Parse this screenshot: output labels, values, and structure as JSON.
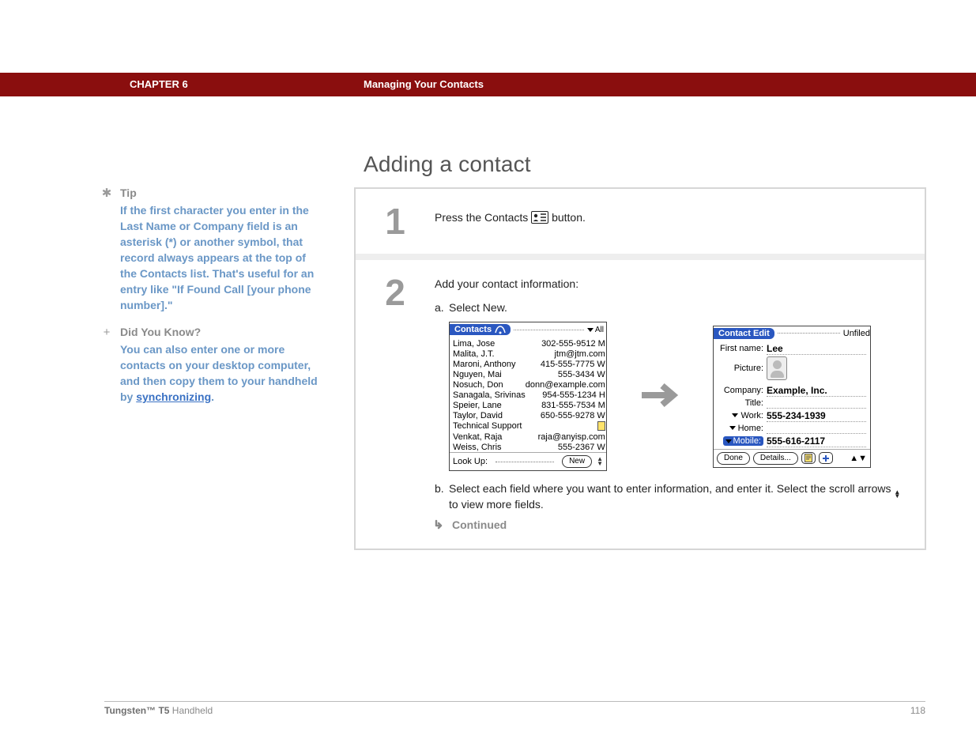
{
  "header": {
    "chapter": "CHAPTER 6",
    "subtitle": "Managing Your Contacts"
  },
  "heading": "Adding a contact",
  "sidebar": {
    "tip": {
      "title": "Tip",
      "body": "If the first character you enter in the Last Name or Company field is an asterisk (*) or another symbol, that record always appears at the top of the Contacts list. That's useful for an entry like \"If Found Call [your phone number].\""
    },
    "dyk": {
      "title": "Did You Know?",
      "body_prefix": "You can also enter one or more contacts on your desktop computer, and then copy them to your handheld by ",
      "link": "synchronizing",
      "suffix": "."
    }
  },
  "steps": {
    "s1": {
      "num": "1",
      "text_a": "Press the Contacts ",
      "text_b": " button."
    },
    "s2": {
      "num": "2",
      "intro": "Add your contact information:",
      "a": "Select New.",
      "b_part1": "Select each field where you want to enter information, and enter it. Select the scroll arrows ",
      "b_part2": " to view more fields.",
      "continued": "Continued"
    }
  },
  "palm_list": {
    "title": "Contacts",
    "category": "All",
    "rows": [
      {
        "name": "Lima, Jose",
        "val": "302-555-9512 M"
      },
      {
        "name": "Malita, J.T.",
        "val": "jtm@jtm.com"
      },
      {
        "name": "Maroni, Anthony",
        "val": "415-555-7775 W"
      },
      {
        "name": "Nguyen, Mai",
        "val": "555-3434 W"
      },
      {
        "name": "Nosuch, Don",
        "val": "donn@example.com"
      },
      {
        "name": "Sanagala, Srivinas",
        "val": "954-555-1234 H"
      },
      {
        "name": "Speier, Lane",
        "val": "831-555-7534 M"
      },
      {
        "name": "Taylor, David",
        "val": "650-555-9278 W"
      },
      {
        "name": "Technical Support",
        "val": "",
        "note": true
      },
      {
        "name": "Venkat, Raja",
        "val": "raja@anyisp.com"
      },
      {
        "name": "Weiss, Chris",
        "val": "555-2367 W"
      }
    ],
    "lookup": "Look Up:",
    "new_btn": "New"
  },
  "palm_edit": {
    "title": "Contact Edit",
    "category": "Unfiled",
    "fields": {
      "firstname_label": "First name:",
      "firstname_value": "Lee",
      "picture_label": "Picture:",
      "company_label": "Company:",
      "company_value": "Example, Inc.",
      "title_label": "Title:",
      "work_label": "Work:",
      "work_value": "555-234-1939",
      "home_label": "Home:",
      "mobile_label": "Mobile:",
      "mobile_value": "555-616-2117"
    },
    "done": "Done",
    "details": "Details..."
  },
  "footer": {
    "product_bold": "Tungsten™ T5",
    "product_rest": " Handheld",
    "page": "118"
  }
}
